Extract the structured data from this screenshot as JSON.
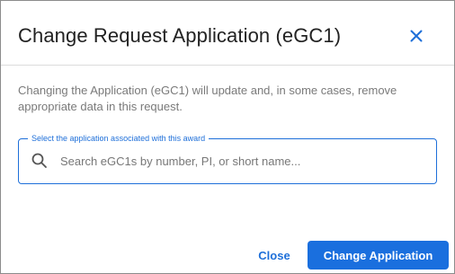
{
  "dialog": {
    "title": "Change Request Application (eGC1)",
    "close_icon": "close-icon",
    "description": "Changing the Application (eGC1) will update and, in some cases, remove appropriate data in this request.",
    "field": {
      "label": "Select the application associated with this award",
      "placeholder": "Search eGC1s by number, PI, or short name...",
      "value": "",
      "icon": "search-icon"
    },
    "footer": {
      "close_label": "Close",
      "change_label": "Change Application"
    },
    "colors": {
      "accent": "#1a6fde",
      "title_text": "#222222",
      "description_text": "#7a7a7a"
    }
  }
}
